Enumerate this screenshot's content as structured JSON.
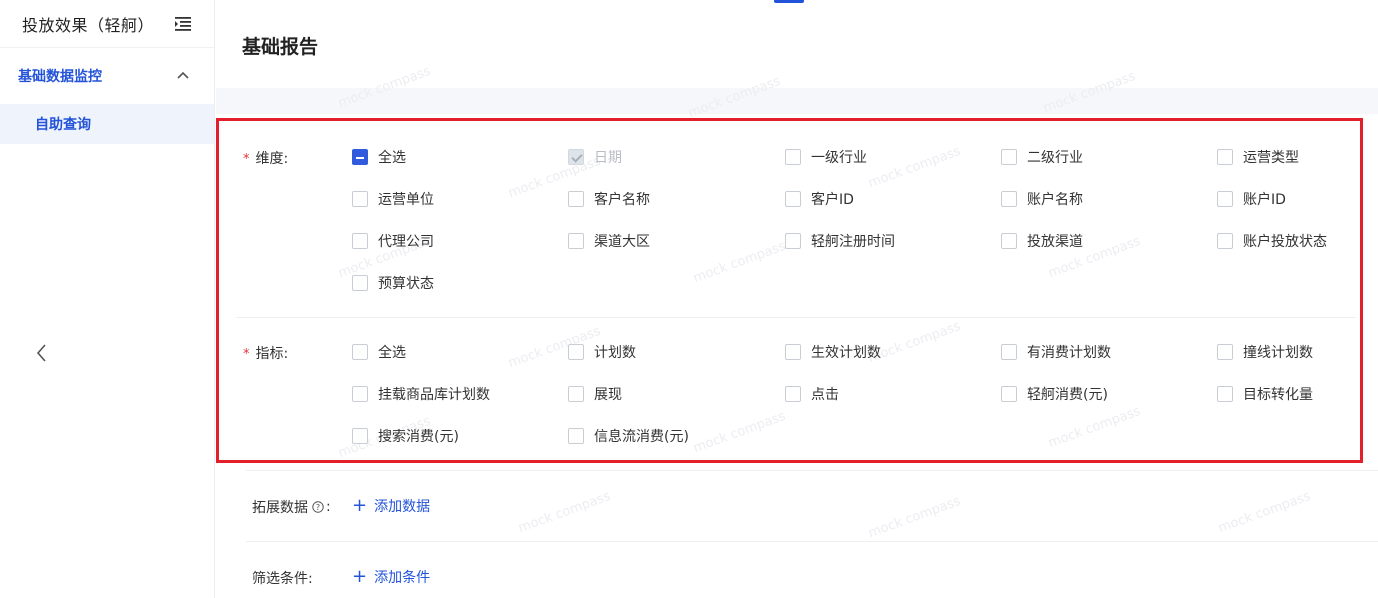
{
  "sidebar": {
    "title": "投放效果（轻舸）",
    "group_label": "基础数据监控",
    "active_item": "自助查询"
  },
  "page": {
    "title": "基础报告",
    "watermark": "mock compass"
  },
  "dimensions": {
    "label": "维度:",
    "options": [
      {
        "label": "全选",
        "state": "partial"
      },
      {
        "label": "日期",
        "state": "checked-disabled"
      },
      {
        "label": "一级行业",
        "state": "unchecked"
      },
      {
        "label": "二级行业",
        "state": "unchecked"
      },
      {
        "label": "运营类型",
        "state": "unchecked"
      },
      {
        "label": "运营单位",
        "state": "unchecked"
      },
      {
        "label": "客户名称",
        "state": "unchecked"
      },
      {
        "label": "客户ID",
        "state": "unchecked"
      },
      {
        "label": "账户名称",
        "state": "unchecked"
      },
      {
        "label": "账户ID",
        "state": "unchecked"
      },
      {
        "label": "代理公司",
        "state": "unchecked"
      },
      {
        "label": "渠道大区",
        "state": "unchecked"
      },
      {
        "label": "轻舸注册时间",
        "state": "unchecked"
      },
      {
        "label": "投放渠道",
        "state": "unchecked"
      },
      {
        "label": "账户投放状态",
        "state": "unchecked"
      },
      {
        "label": "预算状态",
        "state": "unchecked"
      }
    ]
  },
  "metrics": {
    "label": "指标:",
    "options": [
      {
        "label": "全选",
        "state": "unchecked"
      },
      {
        "label": "计划数",
        "state": "unchecked"
      },
      {
        "label": "生效计划数",
        "state": "unchecked"
      },
      {
        "label": "有消费计划数",
        "state": "unchecked"
      },
      {
        "label": "撞线计划数",
        "state": "unchecked"
      },
      {
        "label": "挂载商品库计划数",
        "state": "unchecked"
      },
      {
        "label": "展现",
        "state": "unchecked"
      },
      {
        "label": "点击",
        "state": "unchecked"
      },
      {
        "label": "轻舸消费(元)",
        "state": "unchecked"
      },
      {
        "label": "目标转化量",
        "state": "unchecked"
      },
      {
        "label": "搜索消费(元)",
        "state": "unchecked"
      },
      {
        "label": "信息流消费(元)",
        "state": "unchecked"
      }
    ]
  },
  "extended": {
    "label": "拓展数据",
    "add_label": "添加数据"
  },
  "filters": {
    "label": "筛选条件:",
    "add_label": "添加条件"
  },
  "colors": {
    "accent": "#2353d8",
    "highlight_border": "#e21f2a",
    "required": "#e0333a"
  }
}
